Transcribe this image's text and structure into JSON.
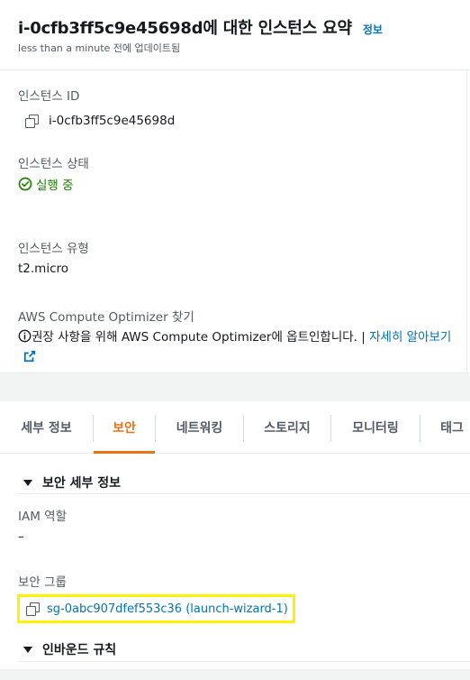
{
  "header": {
    "title": "i-0cfb3ff5c9e45698d에 대한 인스턴스 요약",
    "info_link": "정보",
    "subtitle": "less than a minute 전에 업데이트됨"
  },
  "fields": {
    "instance_id_label": "인스턴스 ID",
    "instance_id_value": "i-0cfb3ff5c9e45698d",
    "state_label": "인스턴스 상태",
    "state_value": "실행 중",
    "type_label": "인스턴스 유형",
    "type_value": "t2.micro",
    "optimizer_label": "AWS Compute Optimizer 찾기",
    "optimizer_text": "권장 사항을 위해 AWS Compute Optimizer에 옵트인합니다. | ",
    "optimizer_link": "자세히 알아보기"
  },
  "tabs": [
    {
      "label": "세부 정보",
      "active": false
    },
    {
      "label": "보안",
      "active": true
    },
    {
      "label": "네트워킹",
      "active": false
    },
    {
      "label": "스토리지",
      "active": false
    },
    {
      "label": "모니터링",
      "active": false
    },
    {
      "label": "태그",
      "active": false
    }
  ],
  "security": {
    "section_title": "보안 세부 정보",
    "iam_label": "IAM 역할",
    "iam_value": "–",
    "sg_label": "보안 그룹",
    "sg_value": "sg-0abc907dfef553c36 (launch-wizard-1)",
    "inbound_title": "인바운드 규칙"
  },
  "colors": {
    "accent": "#ec7211",
    "link": "#0073bb",
    "success": "#1d8102",
    "highlight": "#fff200"
  },
  "icons": {
    "copy": "copy-icon",
    "status": "check-circle-icon",
    "info": "info-icon",
    "external": "external-link-icon",
    "caret": "caret-down-icon"
  }
}
